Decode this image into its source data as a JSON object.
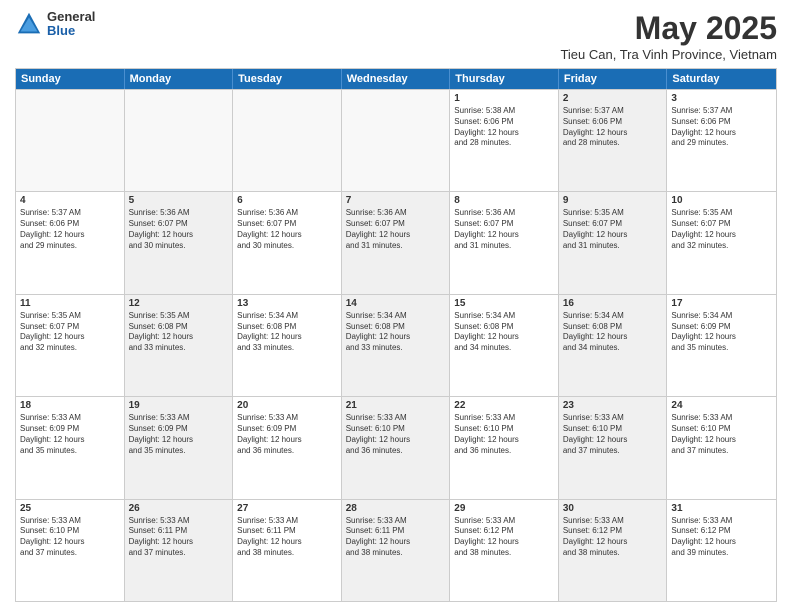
{
  "logo": {
    "general": "General",
    "blue": "Blue"
  },
  "title": "May 2025",
  "subtitle": "Tieu Can, Tra Vinh Province, Vietnam",
  "header_days": [
    "Sunday",
    "Monday",
    "Tuesday",
    "Wednesday",
    "Thursday",
    "Friday",
    "Saturday"
  ],
  "weeks": [
    [
      {
        "day": "",
        "text": "",
        "shaded": true
      },
      {
        "day": "",
        "text": "",
        "shaded": true
      },
      {
        "day": "",
        "text": "",
        "shaded": true
      },
      {
        "day": "",
        "text": "",
        "shaded": true
      },
      {
        "day": "1",
        "text": "Sunrise: 5:38 AM\nSunset: 6:06 PM\nDaylight: 12 hours\nand 28 minutes.",
        "shaded": false
      },
      {
        "day": "2",
        "text": "Sunrise: 5:37 AM\nSunset: 6:06 PM\nDaylight: 12 hours\nand 28 minutes.",
        "shaded": true
      },
      {
        "day": "3",
        "text": "Sunrise: 5:37 AM\nSunset: 6:06 PM\nDaylight: 12 hours\nand 29 minutes.",
        "shaded": false
      }
    ],
    [
      {
        "day": "4",
        "text": "Sunrise: 5:37 AM\nSunset: 6:06 PM\nDaylight: 12 hours\nand 29 minutes.",
        "shaded": false
      },
      {
        "day": "5",
        "text": "Sunrise: 5:36 AM\nSunset: 6:07 PM\nDaylight: 12 hours\nand 30 minutes.",
        "shaded": true
      },
      {
        "day": "6",
        "text": "Sunrise: 5:36 AM\nSunset: 6:07 PM\nDaylight: 12 hours\nand 30 minutes.",
        "shaded": false
      },
      {
        "day": "7",
        "text": "Sunrise: 5:36 AM\nSunset: 6:07 PM\nDaylight: 12 hours\nand 31 minutes.",
        "shaded": true
      },
      {
        "day": "8",
        "text": "Sunrise: 5:36 AM\nSunset: 6:07 PM\nDaylight: 12 hours\nand 31 minutes.",
        "shaded": false
      },
      {
        "day": "9",
        "text": "Sunrise: 5:35 AM\nSunset: 6:07 PM\nDaylight: 12 hours\nand 31 minutes.",
        "shaded": true
      },
      {
        "day": "10",
        "text": "Sunrise: 5:35 AM\nSunset: 6:07 PM\nDaylight: 12 hours\nand 32 minutes.",
        "shaded": false
      }
    ],
    [
      {
        "day": "11",
        "text": "Sunrise: 5:35 AM\nSunset: 6:07 PM\nDaylight: 12 hours\nand 32 minutes.",
        "shaded": false
      },
      {
        "day": "12",
        "text": "Sunrise: 5:35 AM\nSunset: 6:08 PM\nDaylight: 12 hours\nand 33 minutes.",
        "shaded": true
      },
      {
        "day": "13",
        "text": "Sunrise: 5:34 AM\nSunset: 6:08 PM\nDaylight: 12 hours\nand 33 minutes.",
        "shaded": false
      },
      {
        "day": "14",
        "text": "Sunrise: 5:34 AM\nSunset: 6:08 PM\nDaylight: 12 hours\nand 33 minutes.",
        "shaded": true
      },
      {
        "day": "15",
        "text": "Sunrise: 5:34 AM\nSunset: 6:08 PM\nDaylight: 12 hours\nand 34 minutes.",
        "shaded": false
      },
      {
        "day": "16",
        "text": "Sunrise: 5:34 AM\nSunset: 6:08 PM\nDaylight: 12 hours\nand 34 minutes.",
        "shaded": true
      },
      {
        "day": "17",
        "text": "Sunrise: 5:34 AM\nSunset: 6:09 PM\nDaylight: 12 hours\nand 35 minutes.",
        "shaded": false
      }
    ],
    [
      {
        "day": "18",
        "text": "Sunrise: 5:33 AM\nSunset: 6:09 PM\nDaylight: 12 hours\nand 35 minutes.",
        "shaded": false
      },
      {
        "day": "19",
        "text": "Sunrise: 5:33 AM\nSunset: 6:09 PM\nDaylight: 12 hours\nand 35 minutes.",
        "shaded": true
      },
      {
        "day": "20",
        "text": "Sunrise: 5:33 AM\nSunset: 6:09 PM\nDaylight: 12 hours\nand 36 minutes.",
        "shaded": false
      },
      {
        "day": "21",
        "text": "Sunrise: 5:33 AM\nSunset: 6:10 PM\nDaylight: 12 hours\nand 36 minutes.",
        "shaded": true
      },
      {
        "day": "22",
        "text": "Sunrise: 5:33 AM\nSunset: 6:10 PM\nDaylight: 12 hours\nand 36 minutes.",
        "shaded": false
      },
      {
        "day": "23",
        "text": "Sunrise: 5:33 AM\nSunset: 6:10 PM\nDaylight: 12 hours\nand 37 minutes.",
        "shaded": true
      },
      {
        "day": "24",
        "text": "Sunrise: 5:33 AM\nSunset: 6:10 PM\nDaylight: 12 hours\nand 37 minutes.",
        "shaded": false
      }
    ],
    [
      {
        "day": "25",
        "text": "Sunrise: 5:33 AM\nSunset: 6:10 PM\nDaylight: 12 hours\nand 37 minutes.",
        "shaded": false
      },
      {
        "day": "26",
        "text": "Sunrise: 5:33 AM\nSunset: 6:11 PM\nDaylight: 12 hours\nand 37 minutes.",
        "shaded": true
      },
      {
        "day": "27",
        "text": "Sunrise: 5:33 AM\nSunset: 6:11 PM\nDaylight: 12 hours\nand 38 minutes.",
        "shaded": false
      },
      {
        "day": "28",
        "text": "Sunrise: 5:33 AM\nSunset: 6:11 PM\nDaylight: 12 hours\nand 38 minutes.",
        "shaded": true
      },
      {
        "day": "29",
        "text": "Sunrise: 5:33 AM\nSunset: 6:12 PM\nDaylight: 12 hours\nand 38 minutes.",
        "shaded": false
      },
      {
        "day": "30",
        "text": "Sunrise: 5:33 AM\nSunset: 6:12 PM\nDaylight: 12 hours\nand 38 minutes.",
        "shaded": true
      },
      {
        "day": "31",
        "text": "Sunrise: 5:33 AM\nSunset: 6:12 PM\nDaylight: 12 hours\nand 39 minutes.",
        "shaded": false
      }
    ]
  ]
}
